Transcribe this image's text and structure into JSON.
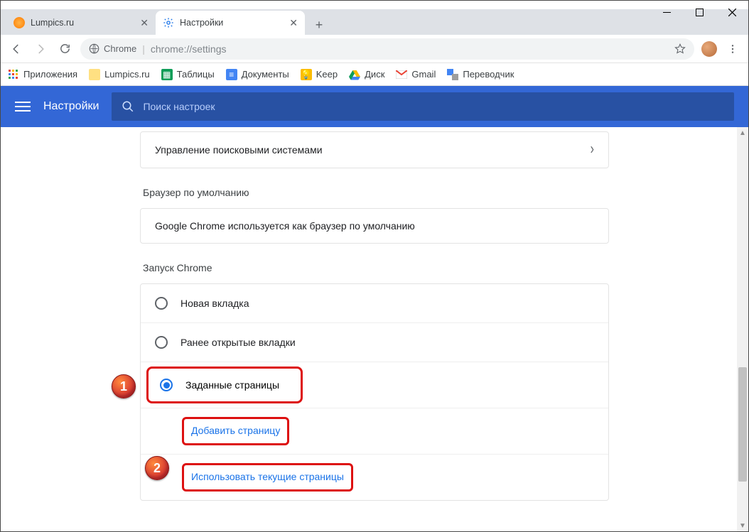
{
  "window": {
    "tabs": [
      {
        "title": "Lumpics.ru",
        "active": false
      },
      {
        "title": "Настройки",
        "active": true
      }
    ]
  },
  "omnibox": {
    "label": "Chrome",
    "url": "chrome://settings"
  },
  "bookmarks": [
    {
      "label": "Приложения"
    },
    {
      "label": "Lumpics.ru"
    },
    {
      "label": "Таблицы"
    },
    {
      "label": "Документы"
    },
    {
      "label": "Keep"
    },
    {
      "label": "Диск"
    },
    {
      "label": "Gmail"
    },
    {
      "label": "Переводчик"
    }
  ],
  "settings_header": {
    "title": "Настройки",
    "search_placeholder": "Поиск настроек"
  },
  "sections": {
    "search_engines_row": "Управление поисковыми системами",
    "default_browser_title": "Браузер по умолчанию",
    "default_browser_text": "Google Chrome используется как браузер по умолчанию",
    "startup_title": "Запуск Chrome",
    "startup_options": {
      "new_tab": "Новая вкладка",
      "restore": "Ранее открытые вкладки",
      "specific": "Заданные страницы"
    },
    "startup_links": {
      "add_page": "Добавить страницу",
      "use_current": "Использовать текущие страницы"
    }
  },
  "annotations": {
    "marker1": "1",
    "marker2": "2"
  }
}
